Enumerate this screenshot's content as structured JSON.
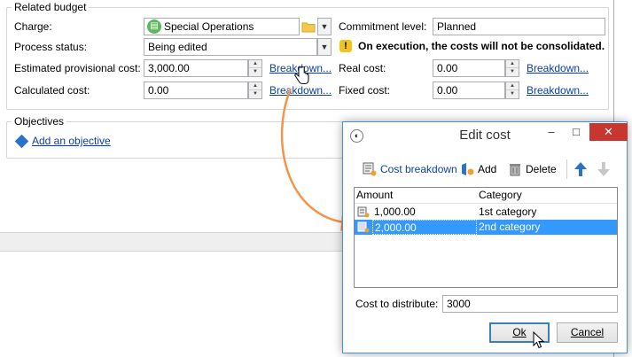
{
  "related_budget": {
    "legend": "Related budget",
    "charge_label": "Charge:",
    "charge_value": "Special Operations",
    "commitment_label": "Commitment level:",
    "commitment_value": "Planned",
    "process_status_label": "Process status:",
    "process_status_value": "Being edited",
    "warning_text": "On execution, the costs will not be consolidated.",
    "estimated_label": "Estimated provisional cost:",
    "estimated_value": "3,000.00",
    "breakdown_link": "Breakdown...",
    "real_cost_label": "Real cost:",
    "real_cost_value": "0.00",
    "calculated_label": "Calculated cost:",
    "calculated_value": "0.00",
    "fixed_cost_label": "Fixed cost:",
    "fixed_cost_value": "0.00"
  },
  "objectives": {
    "legend": "Objectives",
    "add_link": "Add an objective"
  },
  "dialog": {
    "title": "Edit cost",
    "toolbar": {
      "cost_breakdown": "Cost breakdown",
      "add": "Add",
      "delete": "Delete"
    },
    "columns": [
      "Amount",
      "Category"
    ],
    "rows": [
      {
        "amount": "1,000.00",
        "category": "1st category",
        "selected": false
      },
      {
        "amount": "2,000.00",
        "category": "2nd category",
        "selected": true
      }
    ],
    "cost_to_distribute_label": "Cost to distribute:",
    "cost_to_distribute_value": "3000",
    "ok": "Ok",
    "cancel": "Cancel",
    "window_buttons": {
      "minimize": "–",
      "maximize": "□",
      "close": "✕"
    }
  },
  "colors": {
    "accent_arrow": "#f0954a",
    "selection": "#3399ff",
    "link": "#0b3fa8",
    "warning": "#f0c419",
    "close_button": "#c7372f"
  }
}
